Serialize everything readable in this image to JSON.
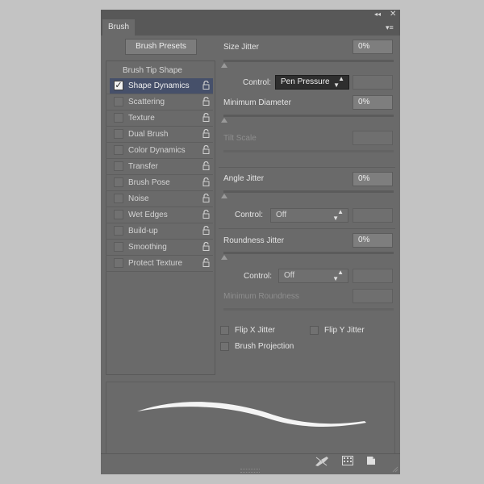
{
  "window": {
    "tab_title": "Brush",
    "collapse_icon": "double-chevron-left",
    "close_icon": "close",
    "menu_icon": "panel-menu"
  },
  "sidebar": {
    "presets_button": "Brush Presets",
    "header": "Brush Tip Shape",
    "items": [
      {
        "label": "Shape Dynamics",
        "checked": true,
        "selected": true
      },
      {
        "label": "Scattering",
        "checked": false
      },
      {
        "label": "Texture",
        "checked": false
      },
      {
        "label": "Dual Brush",
        "checked": false
      },
      {
        "label": "Color Dynamics",
        "checked": false
      },
      {
        "label": "Transfer",
        "checked": false
      },
      {
        "label": "Brush Pose",
        "checked": false
      },
      {
        "label": "Noise",
        "checked": false
      },
      {
        "label": "Wet Edges",
        "checked": false
      },
      {
        "label": "Build-up",
        "checked": false
      },
      {
        "label": "Smoothing",
        "checked": false
      },
      {
        "label": "Protect Texture",
        "checked": false
      }
    ],
    "checkmark": "✓"
  },
  "settings": {
    "size_jitter": {
      "label": "Size Jitter",
      "value": "0%"
    },
    "size_control": {
      "label": "Control:",
      "value": "Pen Pressure"
    },
    "min_diameter": {
      "label": "Minimum Diameter",
      "value": "0%"
    },
    "tilt_scale": {
      "label": "Tilt Scale"
    },
    "angle_jitter": {
      "label": "Angle Jitter",
      "value": "0%"
    },
    "angle_control": {
      "label": "Control:",
      "value": "Off"
    },
    "roundness_jitter": {
      "label": "Roundness Jitter",
      "value": "0%"
    },
    "roundness_control": {
      "label": "Control:",
      "value": "Off"
    },
    "min_roundness": {
      "label": "Minimum Roundness"
    },
    "flip_x": {
      "label": "Flip X Jitter",
      "checked": false
    },
    "flip_y": {
      "label": "Flip Y Jitter",
      "checked": false
    },
    "brush_projection": {
      "label": "Brush Projection",
      "checked": false
    }
  },
  "footer": {
    "icons": [
      "brush-toggle-icon",
      "grid-icon",
      "new-brush-icon"
    ]
  },
  "colors": {
    "panel_bg": "#6a6a6a",
    "selection": "#46506a",
    "active_dropdown": "#2e2e2e"
  }
}
